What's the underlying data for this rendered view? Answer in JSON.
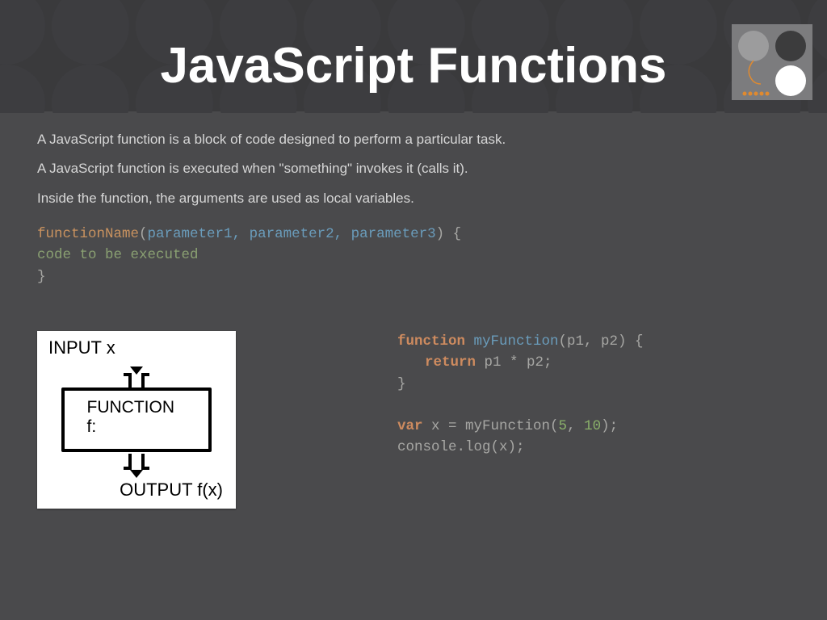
{
  "title": "JavaScript Functions",
  "paragraphs": {
    "p1": "A JavaScript function is a block of code designed to perform a particular task.",
    "p2": "A JavaScript function is executed when \"something\" invokes it (calls it).",
    "p3": "Inside the function, the arguments are used as local variables."
  },
  "syntax": {
    "fn_name": "functionName",
    "open": "(",
    "params": "parameter1, parameter2, parameter3",
    "close_brace": ") {",
    "body": "   code to be executed",
    "end": "}"
  },
  "diagram": {
    "input": "INPUT x",
    "function": "FUNCTION f:",
    "output": "OUTPUT f(x)"
  },
  "code": {
    "l1_kw": "function",
    "l1_name": " myFunction",
    "l1_rest": "(p1, p2) {",
    "l2_kw": "return",
    "l2_rest": " p1 * p2;",
    "l3": "}",
    "l4_kw": "var",
    "l4_mid": " x = myFunction(",
    "l4_n1": "5",
    "l4_sep": ", ",
    "l4_n2": "10",
    "l4_end": ");",
    "l5": "console.log(x);"
  }
}
